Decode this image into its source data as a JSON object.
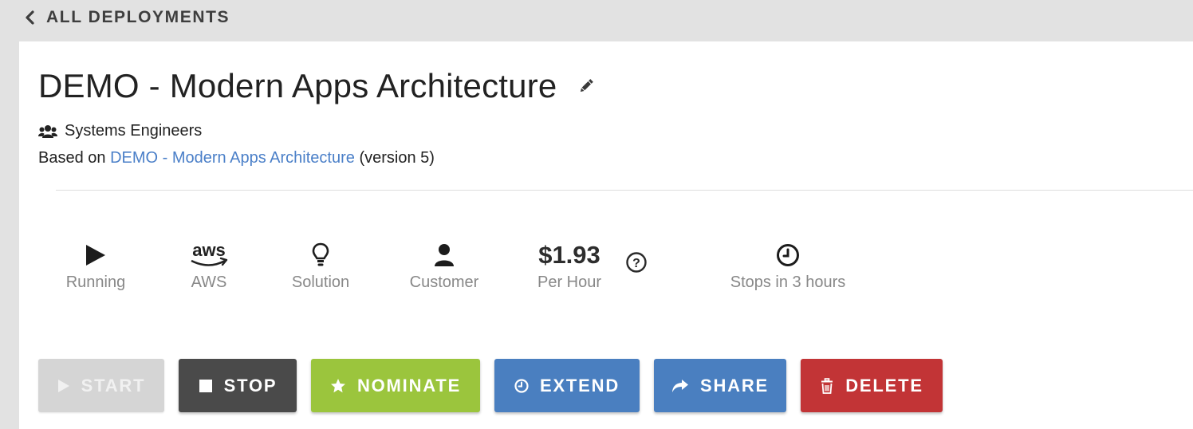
{
  "nav": {
    "back_label": "ALL DEPLOYMENTS"
  },
  "deployment": {
    "title": "DEMO - Modern Apps Architecture",
    "team": "Systems Engineers",
    "based_on_prefix": "Based on",
    "based_on_link": "DEMO - Modern Apps Architecture",
    "based_on_suffix": "(version 5)"
  },
  "stats": {
    "status": "Running",
    "provider": "AWS",
    "provider_logo_text": "aws",
    "type": "Solution",
    "audience": "Customer",
    "price": "$1.93",
    "price_unit": "Per Hour",
    "schedule": "Stops in 3 hours"
  },
  "actions": {
    "start": "START",
    "stop": "STOP",
    "nominate": "NOMINATE",
    "extend": "EXTEND",
    "share": "SHARE",
    "delete": "DELETE"
  },
  "colors": {
    "link": "#4a7fc8",
    "start_disabled": "#d5d5d5",
    "stop": "#4a4a4a",
    "nominate": "#9bc53d",
    "extend": "#4a7fc0",
    "share": "#4a7fc0",
    "delete": "#c23436",
    "label_gray": "#888888"
  }
}
